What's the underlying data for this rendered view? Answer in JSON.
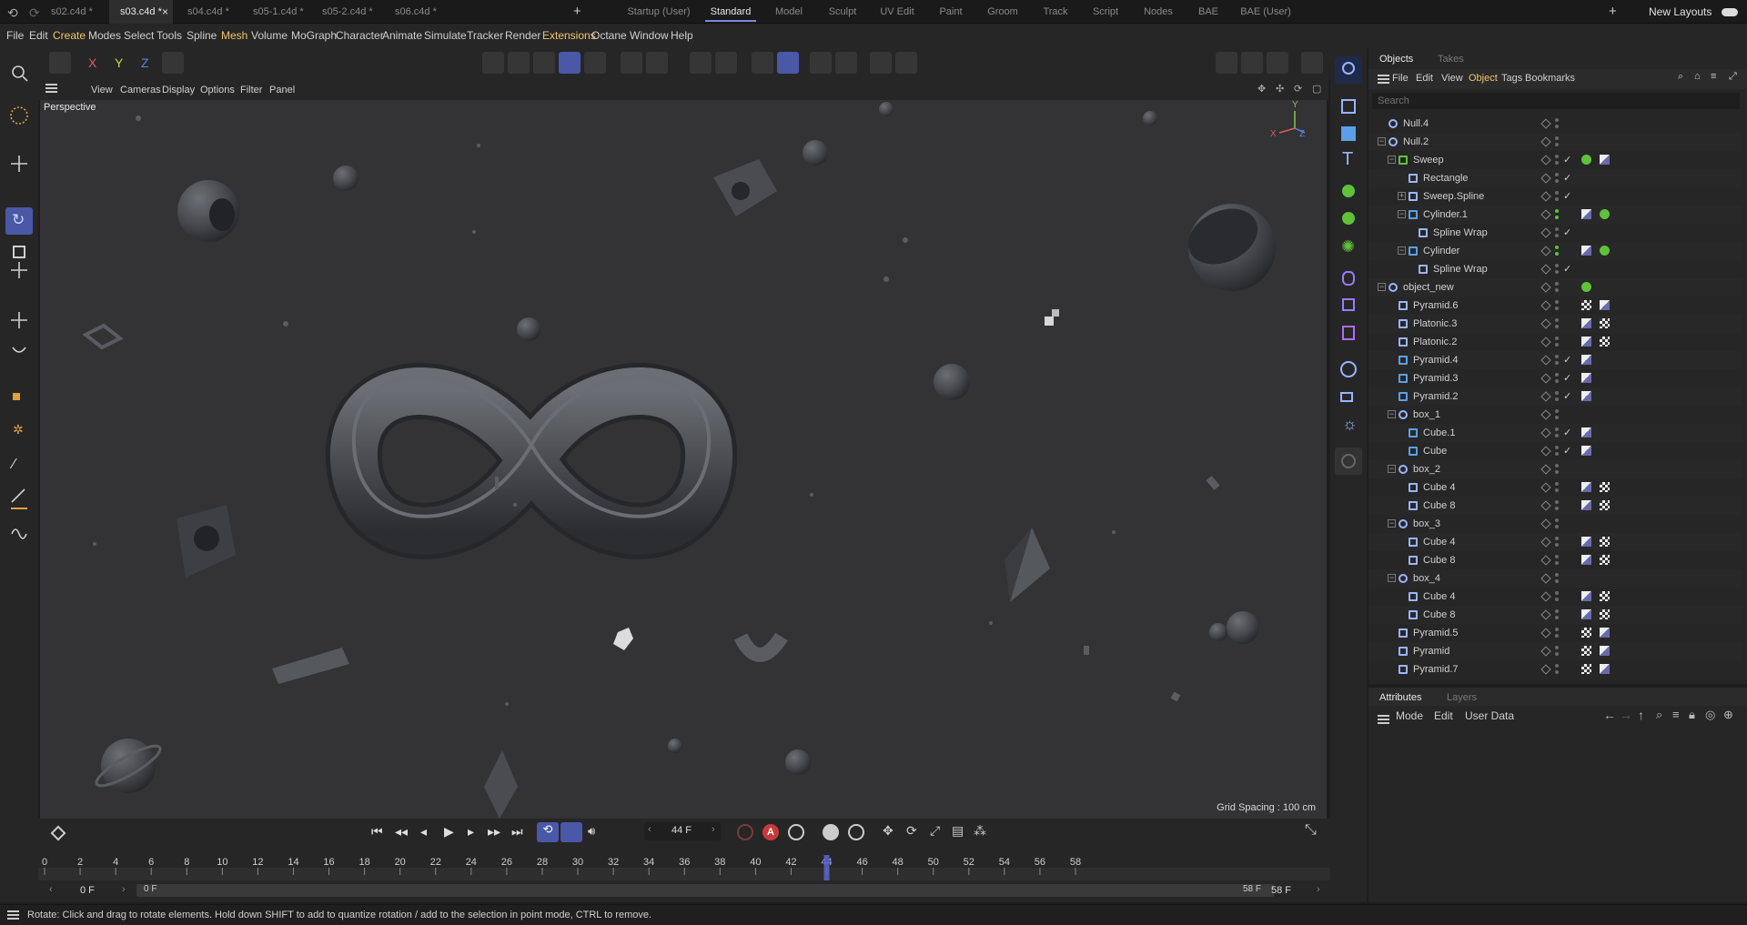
{
  "doc_tabs": [
    {
      "label": "s02.c4d *",
      "active": false
    },
    {
      "label": "s03.c4d *",
      "active": true
    },
    {
      "label": "s04.c4d *",
      "active": false
    },
    {
      "label": "s05-1.c4d *",
      "active": false
    },
    {
      "label": "s05-2.c4d *",
      "active": false
    },
    {
      "label": "s06.c4d *",
      "active": false
    }
  ],
  "layouts": [
    {
      "label": "Startup (User)",
      "active": false
    },
    {
      "label": "Standard",
      "active": true
    },
    {
      "label": "Model",
      "active": false
    },
    {
      "label": "Sculpt",
      "active": false
    },
    {
      "label": "UV Edit",
      "active": false
    },
    {
      "label": "Paint",
      "active": false
    },
    {
      "label": "Groom",
      "active": false
    },
    {
      "label": "Track",
      "active": false
    },
    {
      "label": "Script",
      "active": false
    },
    {
      "label": "Nodes",
      "active": false
    },
    {
      "label": "BAE",
      "active": false
    },
    {
      "label": "BAE (User)",
      "active": false
    }
  ],
  "new_layouts": "New Layouts",
  "menus": [
    {
      "label": "File",
      "hl": false
    },
    {
      "label": "Edit",
      "hl": false
    },
    {
      "label": "Create",
      "hl": true
    },
    {
      "label": "Modes",
      "hl": false
    },
    {
      "label": "Select",
      "hl": false
    },
    {
      "label": "Tools",
      "hl": false
    },
    {
      "label": "Spline",
      "hl": false
    },
    {
      "label": "Mesh",
      "hl": true
    },
    {
      "label": "Volume",
      "hl": false
    },
    {
      "label": "MoGraph",
      "hl": false
    },
    {
      "label": "Character",
      "hl": false
    },
    {
      "label": "Animate",
      "hl": false
    },
    {
      "label": "Simulate",
      "hl": false
    },
    {
      "label": "Tracker",
      "hl": false
    },
    {
      "label": "Render",
      "hl": false
    },
    {
      "label": "Extensions",
      "hl": true
    },
    {
      "label": "Octane",
      "hl": false
    },
    {
      "label": "Window",
      "hl": false
    },
    {
      "label": "Help",
      "hl": false
    }
  ],
  "axis_labels": [
    "X",
    "Y",
    "Z"
  ],
  "viewport_menu": [
    "View",
    "Cameras",
    "Display",
    "Options",
    "Filter",
    "Panel"
  ],
  "viewport": {
    "camera": "Perspective",
    "grid_spacing": "Grid Spacing : 100 cm",
    "axis": [
      "X",
      "Y",
      "Z"
    ]
  },
  "objects_panel": {
    "tabs": [
      "Objects",
      "Takes"
    ],
    "menu": [
      "File",
      "Edit",
      "View",
      "Object",
      "Tags",
      "Bookmarks"
    ],
    "search_placeholder": "Search",
    "rows": [
      {
        "name": "Null.4",
        "depth": 0,
        "icon": "null-icon",
        "tree": "none",
        "dots": "gray",
        "check": false,
        "tags": []
      },
      {
        "name": "Null.2",
        "depth": 0,
        "icon": "null-icon",
        "tree": "minus",
        "dots": "gray",
        "check": false,
        "tags": []
      },
      {
        "name": "Sweep",
        "depth": 1,
        "icon": "sweep-icon",
        "tree": "minus",
        "dots": "gray",
        "check": true,
        "tags": [
          "green",
          "material"
        ]
      },
      {
        "name": "Rectangle",
        "depth": 2,
        "icon": "spline-icon",
        "tree": "none",
        "dots": "gray",
        "check": true,
        "tags": []
      },
      {
        "name": "Sweep.Spline",
        "depth": 2,
        "icon": "spline-icon",
        "tree": "plus",
        "dots": "gray",
        "check": true,
        "tags": []
      },
      {
        "name": "Cylinder.1",
        "depth": 2,
        "icon": "cylinder-icon",
        "tree": "minus",
        "dots": "green",
        "check": false,
        "tags": [
          "material",
          "green"
        ]
      },
      {
        "name": "Spline Wrap",
        "depth": 3,
        "icon": "deformer-icon",
        "tree": "none",
        "dots": "gray",
        "check": true,
        "tags": []
      },
      {
        "name": "Cylinder",
        "depth": 2,
        "icon": "cylinder-icon",
        "tree": "minus",
        "dots": "green",
        "check": false,
        "tags": [
          "material",
          "green"
        ]
      },
      {
        "name": "Spline Wrap",
        "depth": 3,
        "icon": "deformer-icon",
        "tree": "none",
        "dots": "gray",
        "check": true,
        "tags": []
      },
      {
        "name": "object_new",
        "depth": 0,
        "icon": "null-icon",
        "tree": "minus",
        "dots": "gray",
        "check": false,
        "tags": [
          "green"
        ]
      },
      {
        "name": "Pyramid.6",
        "depth": 1,
        "icon": "pyramid-icon",
        "tree": "none",
        "dots": "gray",
        "check": false,
        "tags": [
          "checker",
          "material"
        ]
      },
      {
        "name": "Platonic.3",
        "depth": 1,
        "icon": "pyramid-icon",
        "tree": "none",
        "dots": "gray",
        "check": false,
        "tags": [
          "material",
          "checker"
        ]
      },
      {
        "name": "Platonic.2",
        "depth": 1,
        "icon": "pyramid-icon",
        "tree": "none",
        "dots": "gray",
        "check": false,
        "tags": [
          "material",
          "checker"
        ]
      },
      {
        "name": "Pyramid.4",
        "depth": 1,
        "icon": "pyramid-blue-icon",
        "tree": "none",
        "dots": "gray",
        "check": true,
        "tags": [
          "material"
        ]
      },
      {
        "name": "Pyramid.3",
        "depth": 1,
        "icon": "pyramid-blue-icon",
        "tree": "none",
        "dots": "gray",
        "check": true,
        "tags": [
          "material"
        ]
      },
      {
        "name": "Pyramid.2",
        "depth": 1,
        "icon": "pyramid-blue-icon",
        "tree": "none",
        "dots": "gray",
        "check": true,
        "tags": [
          "material"
        ]
      },
      {
        "name": "box_1",
        "depth": 1,
        "icon": "null-icon",
        "tree": "minus",
        "dots": "gray",
        "check": false,
        "tags": []
      },
      {
        "name": "Cube.1",
        "depth": 2,
        "icon": "cube-icon",
        "tree": "none",
        "dots": "gray",
        "check": true,
        "tags": [
          "material"
        ]
      },
      {
        "name": "Cube",
        "depth": 2,
        "icon": "cube-icon",
        "tree": "none",
        "dots": "gray",
        "check": true,
        "tags": [
          "material"
        ]
      },
      {
        "name": "box_2",
        "depth": 1,
        "icon": "null-icon",
        "tree": "minus",
        "dots": "gray",
        "check": false,
        "tags": []
      },
      {
        "name": "Cube 4",
        "depth": 2,
        "icon": "pyramid-icon",
        "tree": "none",
        "dots": "gray",
        "check": false,
        "tags": [
          "material",
          "checker"
        ]
      },
      {
        "name": "Cube 8",
        "depth": 2,
        "icon": "pyramid-icon",
        "tree": "none",
        "dots": "gray",
        "check": false,
        "tags": [
          "material",
          "checker"
        ]
      },
      {
        "name": "box_3",
        "depth": 1,
        "icon": "null-icon",
        "tree": "minus",
        "dots": "gray",
        "check": false,
        "tags": []
      },
      {
        "name": "Cube 4",
        "depth": 2,
        "icon": "pyramid-icon",
        "tree": "none",
        "dots": "gray",
        "check": false,
        "tags": [
          "material",
          "checker"
        ]
      },
      {
        "name": "Cube 8",
        "depth": 2,
        "icon": "pyramid-icon",
        "tree": "none",
        "dots": "gray",
        "check": false,
        "tags": [
          "material",
          "checker"
        ]
      },
      {
        "name": "box_4",
        "depth": 1,
        "icon": "null-icon",
        "tree": "minus",
        "dots": "gray",
        "check": false,
        "tags": []
      },
      {
        "name": "Cube 4",
        "depth": 2,
        "icon": "pyramid-icon",
        "tree": "none",
        "dots": "gray",
        "check": false,
        "tags": [
          "material",
          "checker"
        ]
      },
      {
        "name": "Cube 8",
        "depth": 2,
        "icon": "pyramid-icon",
        "tree": "none",
        "dots": "gray",
        "check": false,
        "tags": [
          "material",
          "checker"
        ]
      },
      {
        "name": "Pyramid.5",
        "depth": 1,
        "icon": "pyramid-icon",
        "tree": "none",
        "dots": "gray",
        "check": false,
        "tags": [
          "checker",
          "material"
        ]
      },
      {
        "name": "Pyramid",
        "depth": 1,
        "icon": "pyramid-icon",
        "tree": "none",
        "dots": "gray",
        "check": false,
        "tags": [
          "checker",
          "material"
        ]
      },
      {
        "name": "Pyramid.7",
        "depth": 1,
        "icon": "pyramid-icon",
        "tree": "none",
        "dots": "gray",
        "check": false,
        "tags": [
          "checker",
          "material"
        ]
      }
    ]
  },
  "attributes_panel": {
    "tabs": [
      "Attributes",
      "Layers"
    ],
    "menu": [
      "Mode",
      "Edit",
      "User Data"
    ]
  },
  "timeline": {
    "current_frame": "44 F",
    "playhead_frame": 44,
    "start": 0,
    "end": 58,
    "ticks": [
      0,
      2,
      4,
      6,
      8,
      10,
      12,
      14,
      16,
      18,
      20,
      22,
      24,
      26,
      28,
      30,
      32,
      34,
      36,
      38,
      40,
      42,
      44,
      46,
      48,
      50,
      52,
      54,
      56,
      58
    ],
    "range_start_field": "0 F",
    "range_left_label": "0 F",
    "range_right_label": "58 F",
    "range_end_field": "58 F"
  },
  "status": "Rotate: Click and drag to rotate elements. Hold down SHIFT to add to quantize rotation / add to the selection in point mode, CTRL to remove.",
  "colors": {
    "accent": "#4a58a8",
    "highlight_menu": "#f0c76a",
    "tag_green": "#5fc23a",
    "viewport_bg": "#333335"
  }
}
